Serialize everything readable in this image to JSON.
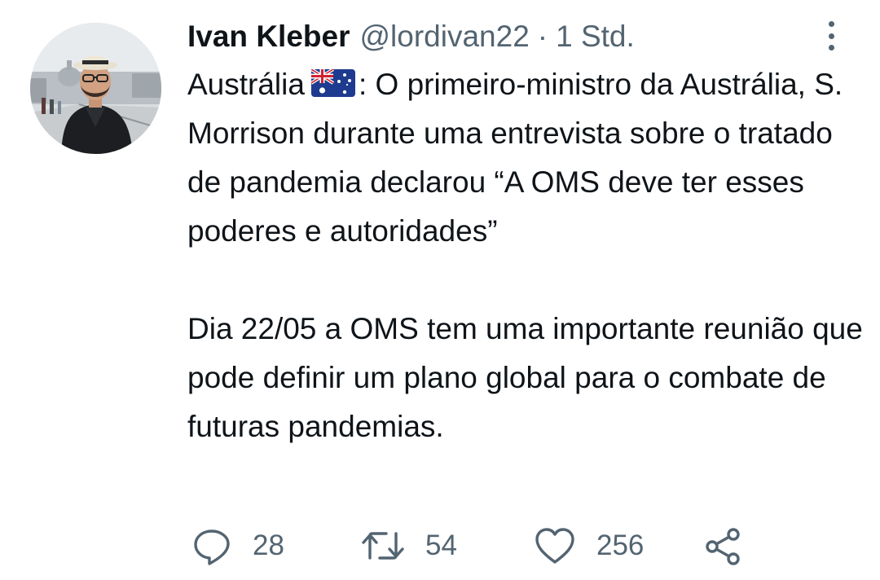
{
  "author": {
    "display_name": "Ivan Kleber",
    "handle": "@lordivan22",
    "separator": "·",
    "time": "1 Std."
  },
  "tweet": {
    "paragraph_1_prefix": "Austrália",
    "flag_icon": "australia-flag",
    "paragraph_1_rest": ": O primeiro-ministro da Austrália, S. Morrison durante uma entrevista sobre o tratado de pandemia declarou “A OMS deve ter esses poderes e autoridades”",
    "paragraph_2": "Dia 22/05 a OMS tem uma importante reunião que pode definir um plano global para o combate de futuras pandemias."
  },
  "actions": {
    "reply": {
      "icon": "reply-icon",
      "count": "28"
    },
    "retweet": {
      "icon": "retweet-icon",
      "count": "54"
    },
    "like": {
      "icon": "heart-icon",
      "count": "256"
    },
    "share": {
      "icon": "share-icon"
    }
  },
  "colors": {
    "text": "#0f1419",
    "secondary": "#536471",
    "background": "#ffffff"
  }
}
